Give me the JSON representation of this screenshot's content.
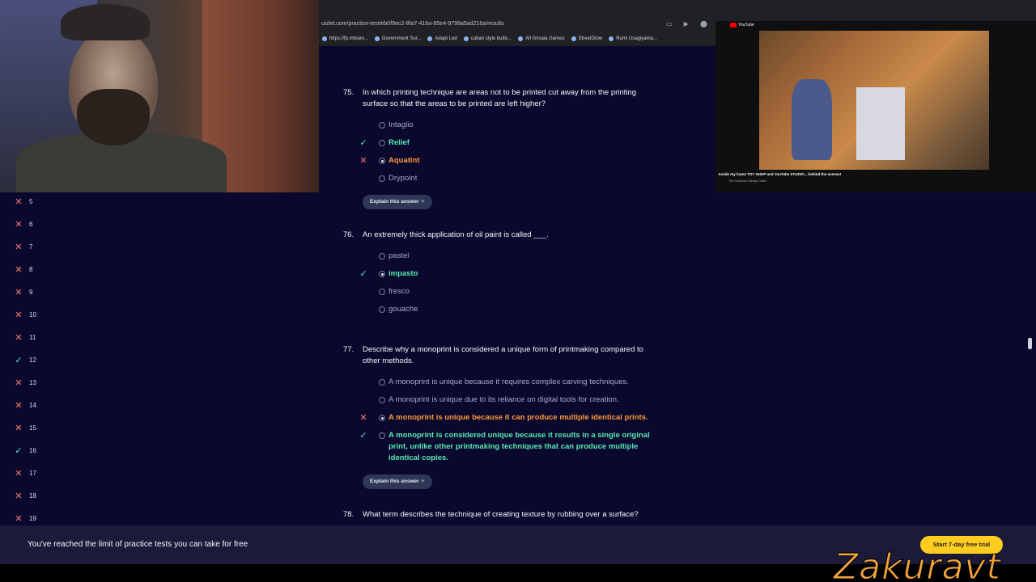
{
  "browser": {
    "url": "uizlet.com/practice-test/eb0f9ec2-8fa7-416a-85e4-9798a5ad216a/results",
    "bookmarks": [
      "https://fp.mbsen...",
      "Government Sur...",
      "Adapt Led",
      "cuban style butto...",
      "All Grisaia Games",
      "StreetGlow",
      "Rumi Usagiyama..."
    ]
  },
  "sidebar": {
    "items": [
      {
        "num": "5",
        "status": "wrong"
      },
      {
        "num": "6",
        "status": "wrong"
      },
      {
        "num": "7",
        "status": "wrong"
      },
      {
        "num": "8",
        "status": "wrong"
      },
      {
        "num": "9",
        "status": "wrong"
      },
      {
        "num": "10",
        "status": "wrong"
      },
      {
        "num": "11",
        "status": "wrong"
      },
      {
        "num": "12",
        "status": "correct"
      },
      {
        "num": "13",
        "status": "wrong"
      },
      {
        "num": "14",
        "status": "wrong"
      },
      {
        "num": "15",
        "status": "wrong"
      },
      {
        "num": "16",
        "status": "correct"
      },
      {
        "num": "17",
        "status": "wrong"
      },
      {
        "num": "18",
        "status": "wrong"
      },
      {
        "num": "19",
        "status": "wrong"
      }
    ]
  },
  "questions": [
    {
      "num": "75.",
      "text": "In which printing technique are areas not to be printed cut away from the printing surface so that the areas to be printed are left higher?",
      "options": [
        {
          "label": "Intaglio",
          "state": "normal"
        },
        {
          "label": "Relief",
          "state": "correct"
        },
        {
          "label": "Aquatint",
          "state": "wrong"
        },
        {
          "label": "Drypoint",
          "state": "normal"
        }
      ],
      "explain": "Explain this answer"
    },
    {
      "num": "76.",
      "text": "An extremely thick application of oil paint is called ___.",
      "options": [
        {
          "label": "pastel",
          "state": "normal"
        },
        {
          "label": "impasto",
          "state": "correct"
        },
        {
          "label": "fresco",
          "state": "normal"
        },
        {
          "label": "gouache",
          "state": "normal"
        }
      ]
    },
    {
      "num": "77.",
      "text": "Describe why a monoprint is considered a unique form of printmaking compared to other methods.",
      "options": [
        {
          "label": "A monoprint is unique because it requires complex carving techniques.",
          "state": "normal"
        },
        {
          "label": "A monoprint is unique due to its reliance on digital tools for creation.",
          "state": "normal"
        },
        {
          "label": "A monoprint is unique because it can produce multiple identical prints.",
          "state": "wrong"
        },
        {
          "label": "A monoprint is considered unique because it results in a single original print, unlike other printmaking techniques that can produce multiple identical copies.",
          "state": "correct"
        }
      ],
      "explain": "Explain this answer"
    },
    {
      "num": "78.",
      "text": "What term describes the technique of creating texture by rubbing over a surface?"
    }
  ],
  "banner": {
    "text": "You've reached the limit of practice tests you can take for free",
    "button": "Start 7-day free trial"
  },
  "video": {
    "logo": "YouTube",
    "title": "Inside my home TOY SHOP and YouTube STUDIO... behind the scenes!",
    "channel": "The Corkscrew Steady Crafter"
  },
  "watermark": "Zakuravt",
  "colors": {
    "page_bg": "#0a092d",
    "correct": "#59e8b5",
    "wrong_text": "#ff983a",
    "wrong_mark": "#ff7873",
    "trial_button": "#ffcd1f"
  }
}
